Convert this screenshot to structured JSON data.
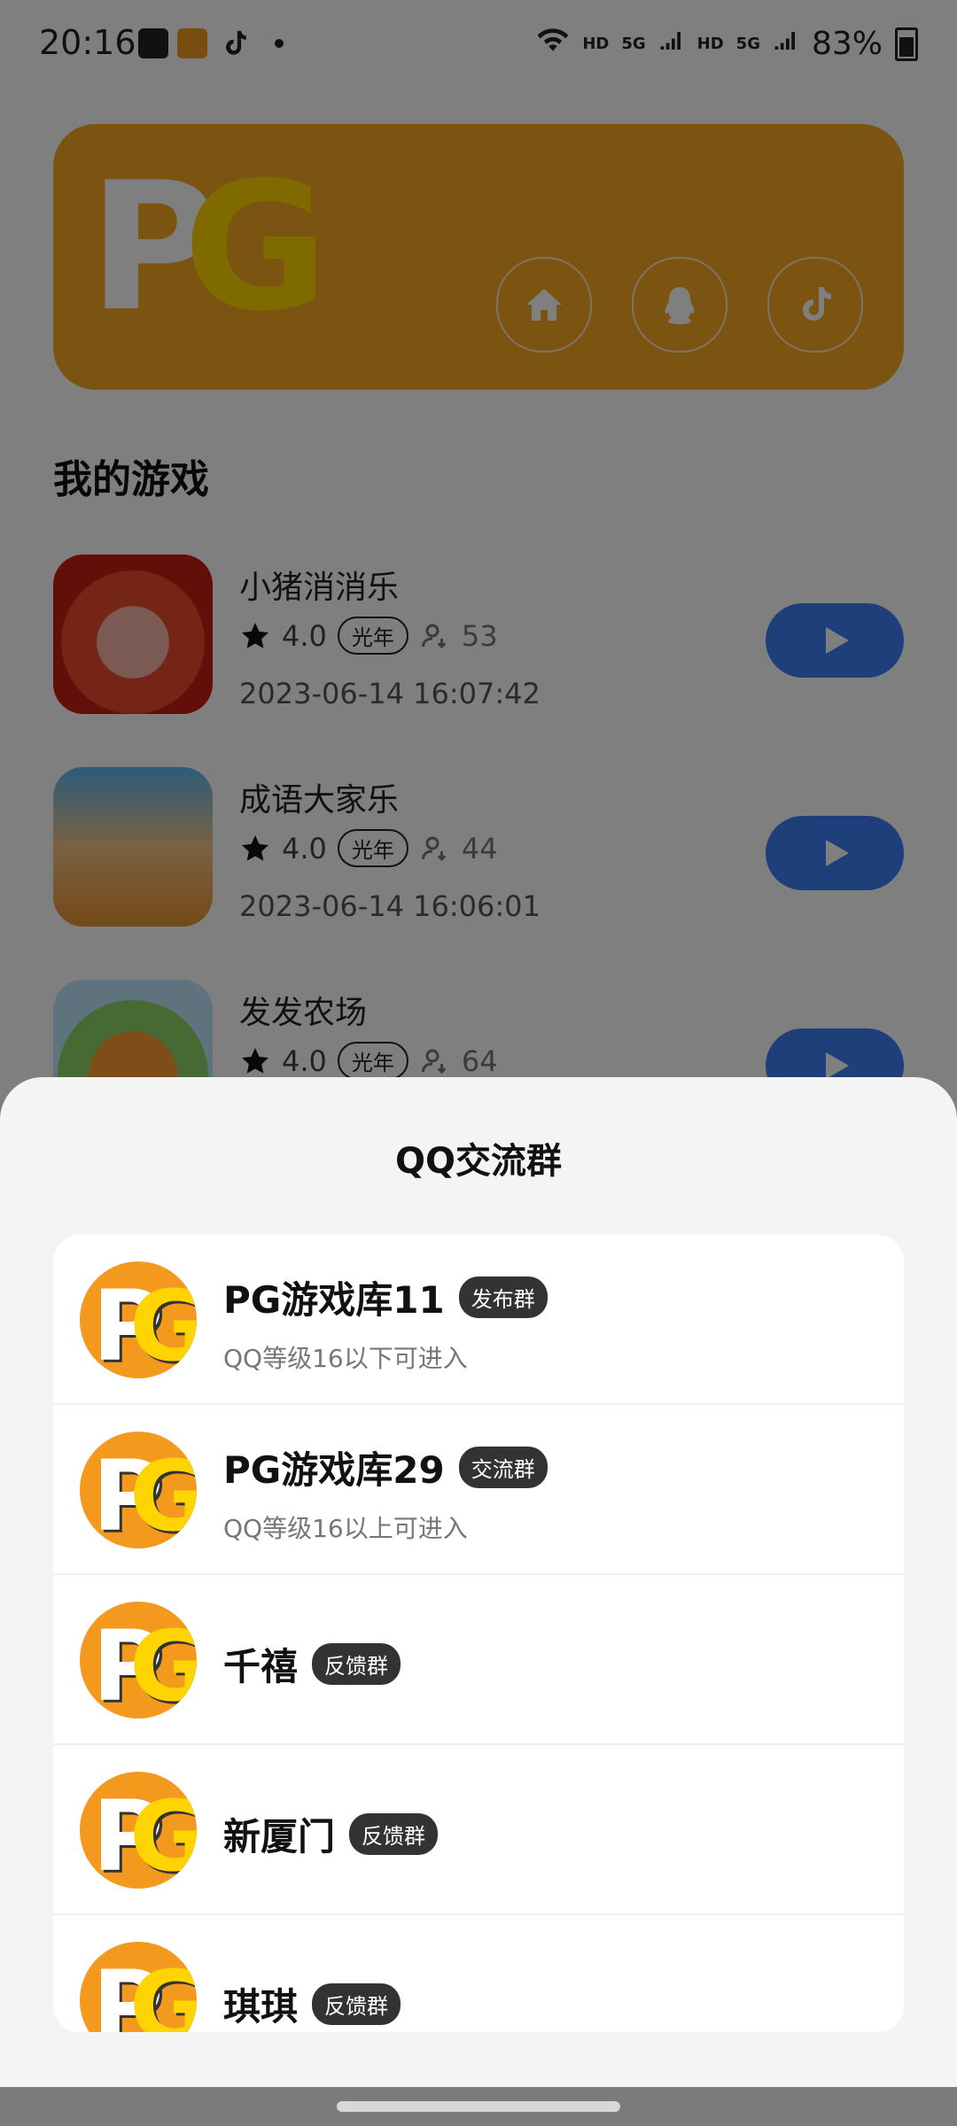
{
  "status_bar": {
    "time": "20:16",
    "right_hd1": "HD",
    "right_5g1": "5G",
    "right_hd2": "HD",
    "right_5g2": "5G",
    "battery": "83%"
  },
  "banner": {
    "logo_p": "P",
    "logo_g": "G",
    "buttons": [
      "home-icon",
      "qq-penguin-icon",
      "tiktok-icon"
    ]
  },
  "my_games": {
    "title": "我的游戏",
    "items": [
      {
        "name": "小猪消消乐",
        "rating": "4.0",
        "tag": "光年",
        "players": "53",
        "date": "2023-06-14 16:07:42"
      },
      {
        "name": "成语大家乐",
        "rating": "4.0",
        "tag": "光年",
        "players": "44",
        "date": "2023-06-14 16:06:01"
      },
      {
        "name": "发发农场",
        "rating": "4.0",
        "tag": "光年",
        "players": "64",
        "date": ""
      }
    ]
  },
  "sheet": {
    "title": "QQ交流群",
    "groups": [
      {
        "name": "PG游戏库11",
        "badge": "发布群",
        "sub": "QQ等级16以下可进入"
      },
      {
        "name": "PG游戏库29",
        "badge": "交流群",
        "sub": "QQ等级16以上可进入"
      },
      {
        "name": "千禧",
        "badge": "反馈群",
        "sub": ""
      },
      {
        "name": "新厦门",
        "badge": "反馈群",
        "sub": ""
      },
      {
        "name": "琪琪",
        "badge": "反馈群",
        "sub": ""
      }
    ],
    "avatar_p": "P",
    "avatar_g": "G"
  },
  "colors": {
    "accent": "#3f7ff7",
    "banner": "#f7a823",
    "overlay": "rgba(0,0,0,0.5)"
  }
}
